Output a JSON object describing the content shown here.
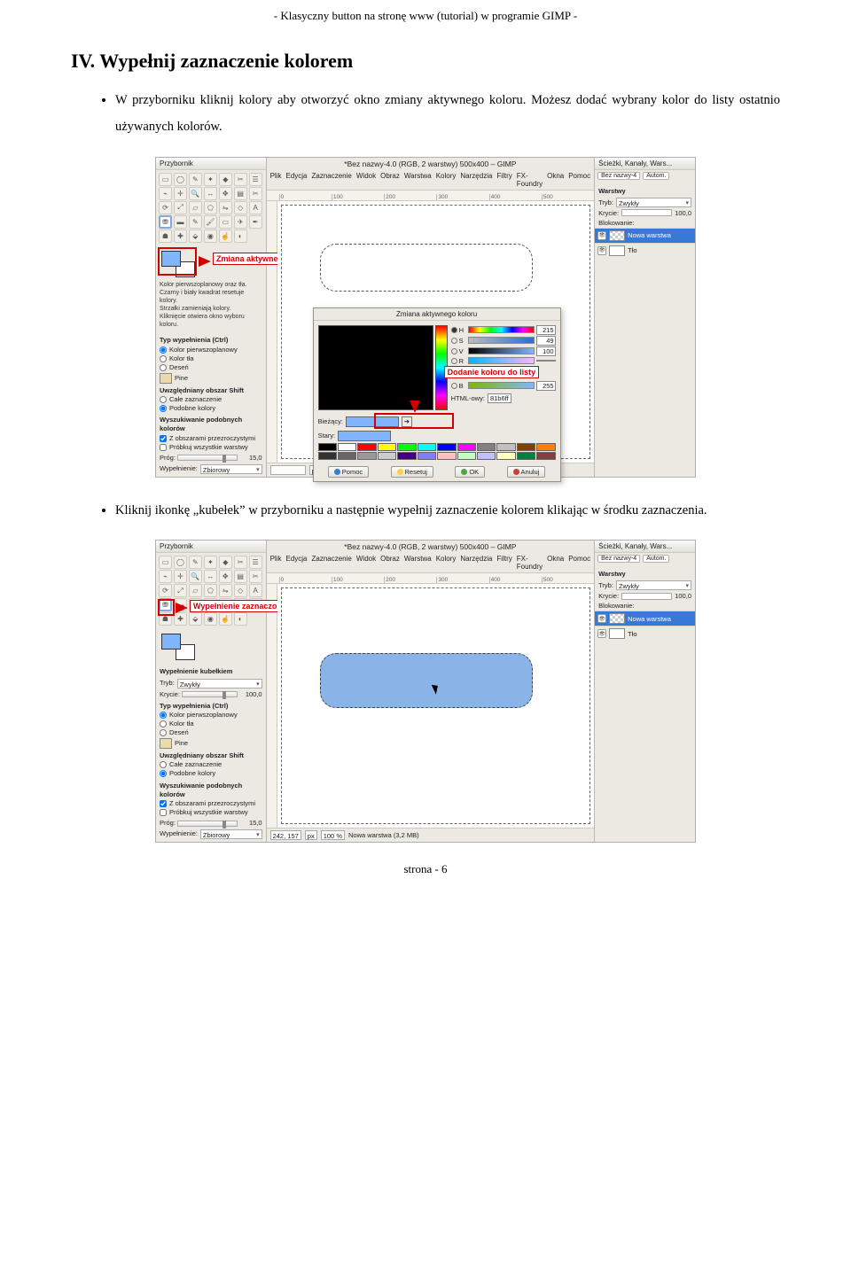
{
  "header": "-   Klasyczny button na stronę www (tutorial) w programie GIMP   -",
  "heading": "IV. Wypełnij zaznaczenie kolorem",
  "bullets": [
    "W przyborniku kliknij kolory aby otworzyć okno zmiany aktywnego koloru.   Możesz dodać wybrany kolor do listy ostatnio używanych kolorów.",
    "Kliknij  ikonkę  „kubełek”  w  przyborniku  a  następnie  wypełnij  zaznaczenie  kolorem klikając w środku zaznaczenia."
  ],
  "footer": "strona - 6",
  "toolbox_title": "Przybornik",
  "canvas_title": "*Bez nazwy-4.0 (RGB, 2 warstwy) 500x400 – GIMP",
  "dock_title": "Ścieżki, Kanały, Wars...",
  "menu": [
    "Plik",
    "Edycja",
    "Zaznaczenie",
    "Widok",
    "Obraz",
    "Warstwa",
    "Kolory",
    "Narzędzia",
    "Filtry",
    "FX-Foundry",
    "Okna",
    "Pomoc"
  ],
  "ruler_marks": [
    "0",
    "100",
    "200",
    "300",
    "400",
    "500"
  ],
  "annot": {
    "fgbg": "Zmiana aktywnego koloru",
    "add_color": "Dodanie koloru do listy",
    "bucket_fill": "Wypełnienie zaznaczonego obszaru kolorem",
    "fgbg_info": "Kolor pierwszoplanowy oraz tła.\nCzarny i biały kwadrat resetuje kolory.\nStrzałki zamieniają kolory.\nKliknięcie otwiera okno wyboru koloru."
  },
  "fill_options": {
    "section": "Typ wypełnienia  (Ctrl)",
    "opt1": "Kolor pierwszoplanowy",
    "opt2": "Kolor tła",
    "opt3": "Deseń",
    "pattern_name": "Pine",
    "shift_section": "Uwzględniany obszar  Shift",
    "shift1": "Całe zaznaczenie",
    "shift2": "Podobne kolory",
    "similar_section": "Wyszukiwanie podobnych kolorów",
    "chk1": "Z obszarami przezroczystymi",
    "chk2": "Próbkuj wszystkie warstwy",
    "thresh_label": "Próg:",
    "thresh_val": "15,0",
    "fillby_label": "Wypełnienie:",
    "fillby_val": "Zbiorowy"
  },
  "bucket_opts": {
    "title": "Wypełnienie kubełkiem",
    "mode_label": "Tryb:",
    "mode_val": "Zwykły",
    "opac_label": "Krycie:",
    "opac_val": "100,0"
  },
  "layers": {
    "tab": "Bez nazwy-4",
    "tab_btn": "Autom.",
    "heading": "Warstwy",
    "mode_label": "Tryb:",
    "mode_val": "Zwykły",
    "opac_label": "Krycie:",
    "opac_val": "100,0",
    "lock_label": "Blokowanie:",
    "layer_new": "Nowa warstwa",
    "layer_bg": "Tło"
  },
  "color_dialog": {
    "title": "Zmiana aktywnego koloru",
    "h_val": "215",
    "s_val": "49",
    "v_val": "100",
    "r_val": "",
    "html_label": "HTML-owy:",
    "html_val": "81b6ff",
    "current_label": "Bieżący:",
    "old_label": "Stary:",
    "btn_help": "Pomoc",
    "btn_reset": "Resetuj",
    "btn_ok": "OK",
    "btn_cancel": "Anuluj"
  },
  "status": {
    "coords2": "242, 157",
    "unit": "px",
    "zoom": "100 %",
    "layer_info": "Nowa warstwa (3,2 MB)"
  },
  "colors": {
    "fg": "#81b6ff",
    "swatches": [
      "#000000",
      "#ffffff",
      "#ff0000",
      "#ffff00",
      "#00ff00",
      "#00ffff",
      "#0000ff",
      "#ff00ff",
      "#808080",
      "#c0c0c0",
      "#804000",
      "#ff8000",
      "#333333",
      "#666666",
      "#999999",
      "#cccccc",
      "#400080",
      "#8080ff",
      "#ffc0c0",
      "#c0ffc0",
      "#c0c0ff",
      "#ffffc0",
      "#008040",
      "#804040"
    ]
  }
}
